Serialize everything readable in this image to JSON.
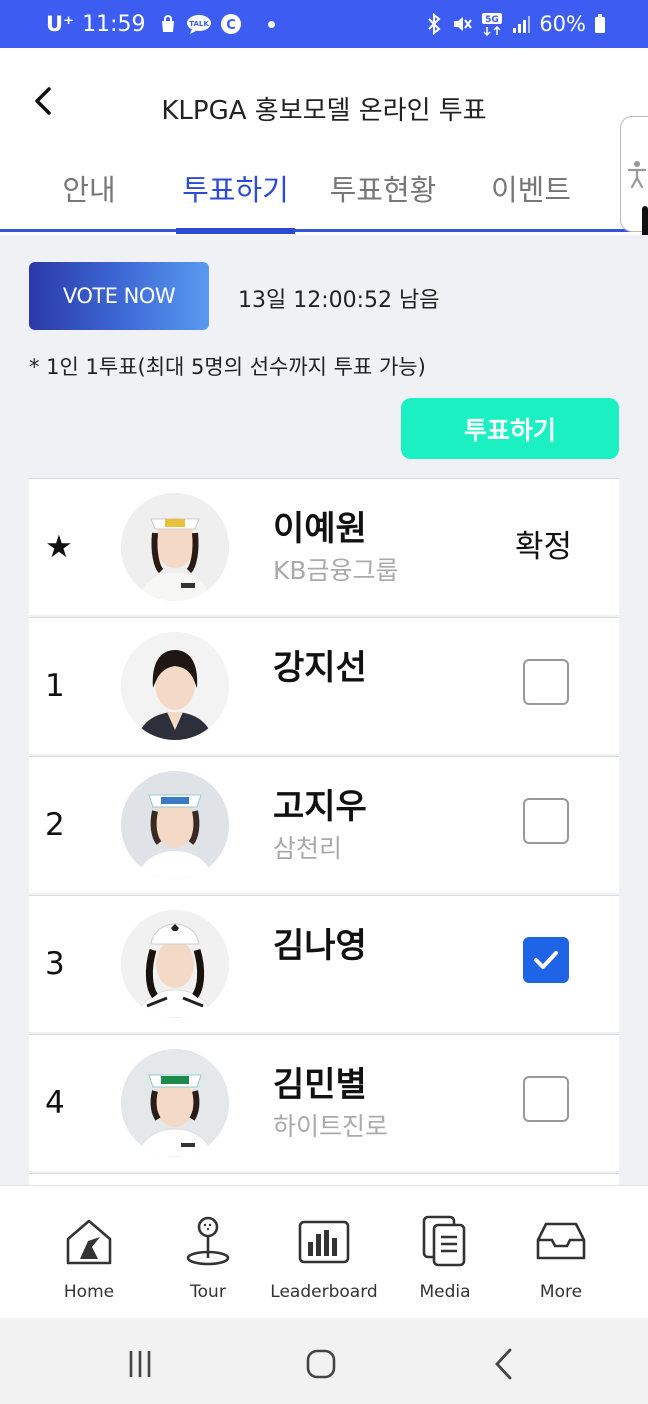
{
  "status_bar": {
    "carrier": "U⁺",
    "time": "11:59",
    "battery": "60%"
  },
  "header": {
    "title": "KLPGA 홍보모델 온라인 투표"
  },
  "tabs": [
    {
      "label": "안내",
      "active": false
    },
    {
      "label": "투표하기",
      "active": true
    },
    {
      "label": "투표현황",
      "active": false
    },
    {
      "label": "이벤트",
      "active": false
    }
  ],
  "vote": {
    "vote_now_label": "VOTE NOW",
    "countdown": "13일 12:00:52 남음",
    "notice": "* 1인 1투표(최대 5명의 선수까지 투표 가능)",
    "submit_label": "투표하기"
  },
  "players": [
    {
      "rank": "★",
      "name": "이예원",
      "team": "KB금융그룹",
      "status": "확정",
      "checked": null
    },
    {
      "rank": "1",
      "name": "강지선",
      "team": "",
      "status": "",
      "checked": false
    },
    {
      "rank": "2",
      "name": "고지우",
      "team": "삼천리",
      "status": "",
      "checked": false
    },
    {
      "rank": "3",
      "name": "김나영",
      "team": "",
      "status": "",
      "checked": true
    },
    {
      "rank": "4",
      "name": "김민별",
      "team": "하이트진로",
      "status": "",
      "checked": false
    }
  ],
  "bottom_nav": [
    {
      "label": "Home",
      "icon": "home-icon"
    },
    {
      "label": "Tour",
      "icon": "tour-icon"
    },
    {
      "label": "Leaderboard",
      "icon": "leaderboard-icon"
    },
    {
      "label": "Media",
      "icon": "media-icon"
    },
    {
      "label": "More",
      "icon": "more-icon"
    }
  ],
  "colors": {
    "status_bar": "#3d5df2",
    "accent": "#2b4bd6",
    "vote_button": "#1af0c2",
    "checkbox_on": "#1f63e6"
  }
}
